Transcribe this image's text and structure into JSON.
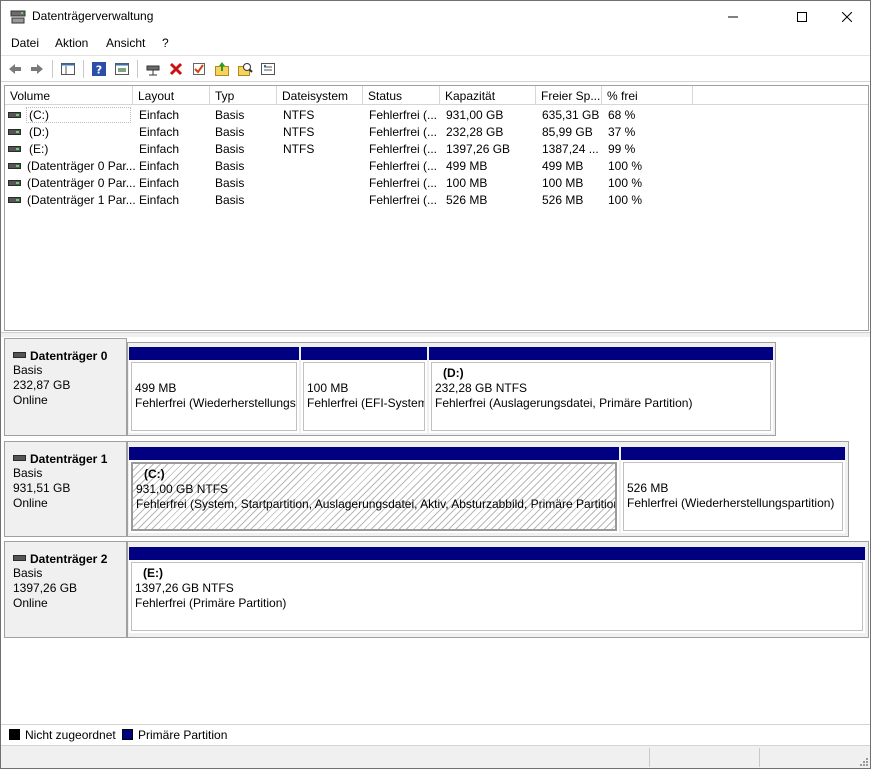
{
  "window": {
    "title": "Datenträgerverwaltung"
  },
  "menu": [
    "Datei",
    "Aktion",
    "Ansicht",
    "?"
  ],
  "toolbar": {
    "icons": [
      "back-arrow-icon",
      "forward-arrow-icon",
      "console-tree-icon",
      "help-icon",
      "properties-icon",
      "connect-disk-icon",
      "delete-icon",
      "check-icon",
      "folder-up-icon",
      "search-icon",
      "settings-list-icon"
    ]
  },
  "volume_list": {
    "columns": [
      "Volume",
      "Layout",
      "Typ",
      "Dateisystem",
      "Status",
      "Kapazität",
      "Freier Sp...",
      "% frei"
    ],
    "rows": [
      [
        "(C:)",
        "Einfach",
        "Basis",
        "NTFS",
        "Fehlerfrei (...",
        "931,00 GB",
        "635,31 GB",
        "68 %"
      ],
      [
        "(D:)",
        "Einfach",
        "Basis",
        "NTFS",
        "Fehlerfrei (...",
        "232,28 GB",
        "85,99 GB",
        "37 %"
      ],
      [
        "(E:)",
        "Einfach",
        "Basis",
        "NTFS",
        "Fehlerfrei (...",
        "1397,26 GB",
        "1387,24 ...",
        "99 %"
      ],
      [
        "(Datenträger 0 Par...",
        "Einfach",
        "Basis",
        "",
        "Fehlerfrei (...",
        "499 MB",
        "499 MB",
        "100 %"
      ],
      [
        "(Datenträger 0 Par...",
        "Einfach",
        "Basis",
        "",
        "Fehlerfrei (...",
        "100 MB",
        "100 MB",
        "100 %"
      ],
      [
        "(Datenträger 1 Par...",
        "Einfach",
        "Basis",
        "",
        "Fehlerfrei (...",
        "526 MB",
        "526 MB",
        "100 %"
      ]
    ]
  },
  "disks": [
    {
      "name": "Datenträger 0",
      "type": "Basis",
      "size": "232,87 GB",
      "state": "Online",
      "partitions": [
        {
          "label": "",
          "line1": "499 MB",
          "line2": "Fehlerfrei (Wiederherstellungs"
        },
        {
          "label": "",
          "line1": "100 MB",
          "line2": "Fehlerfrei (EFI-System"
        },
        {
          "label": "(D:)",
          "line1": "232,28 GB NTFS",
          "line2": "Fehlerfrei (Auslagerungsdatei, Primäre Partition)"
        }
      ]
    },
    {
      "name": "Datenträger 1",
      "type": "Basis",
      "size": "931,51 GB",
      "state": "Online",
      "partitions": [
        {
          "label": "(C:)",
          "line1": "931,00 GB NTFS",
          "line2": "Fehlerfrei (System, Startpartition, Auslagerungsdatei, Aktiv, Absturzabbild, Primäre Partition)"
        },
        {
          "label": "",
          "line1": "526 MB",
          "line2": "Fehlerfrei (Wiederherstellungspartition)"
        }
      ]
    },
    {
      "name": "Datenträger 2",
      "type": "Basis",
      "size": "1397,26 GB",
      "state": "Online",
      "partitions": [
        {
          "label": "(E:)",
          "line1": "1397,26 GB NTFS",
          "line2": "Fehlerfrei (Primäre Partition)"
        }
      ]
    }
  ],
  "legend": [
    {
      "label": "Nicht zugeordnet",
      "color": "#000000"
    },
    {
      "label": "Primäre Partition",
      "color": "#000080"
    }
  ],
  "colors": {
    "partition_bar": "#000080",
    "unallocated": "#000000"
  }
}
